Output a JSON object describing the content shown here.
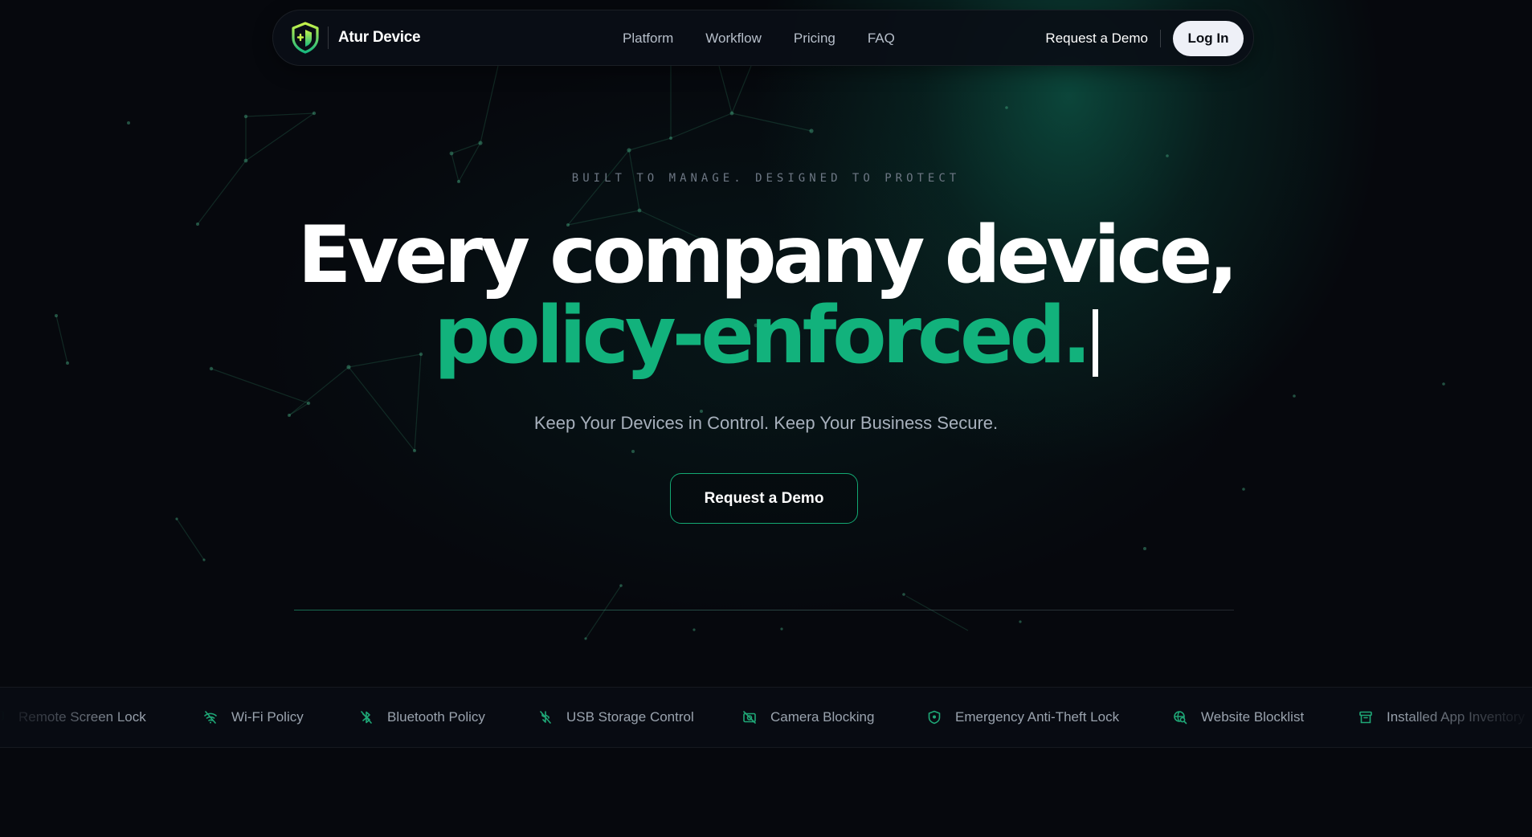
{
  "brand": {
    "name": "Atur Device",
    "logo_icon": "shield-logo-icon",
    "colors": {
      "accent": "#12b27c",
      "logo_top": "#c6f24a",
      "logo_bottom": "#19b87e"
    }
  },
  "nav": {
    "links": [
      "Platform",
      "Workflow",
      "Pricing",
      "FAQ"
    ],
    "demo_label": "Request a Demo",
    "login_label": "Log In"
  },
  "hero": {
    "eyebrow": "BUILT TO MANAGE. DESIGNED TO PROTECT",
    "headline_line1": "Every company device,",
    "headline_line2": "policy-enforced.",
    "subtitle": "Keep Your Devices in Control. Keep Your Business Secure.",
    "cta_label": "Request a Demo"
  },
  "features": [
    {
      "label": "Remote Screen Lock",
      "icon": "screen-lock-icon"
    },
    {
      "label": "Wi-Fi Policy",
      "icon": "wifi-off-icon"
    },
    {
      "label": "Bluetooth Policy",
      "icon": "bluetooth-off-icon"
    },
    {
      "label": "USB Storage Control",
      "icon": "usb-off-icon"
    },
    {
      "label": "Camera Blocking",
      "icon": "camera-off-icon"
    },
    {
      "label": "Emergency Anti-Theft Lock",
      "icon": "shield-lock-icon"
    },
    {
      "label": "Website Blocklist",
      "icon": "globe-search-icon"
    },
    {
      "label": "Installed App Inventory",
      "icon": "archive-icon"
    }
  ]
}
